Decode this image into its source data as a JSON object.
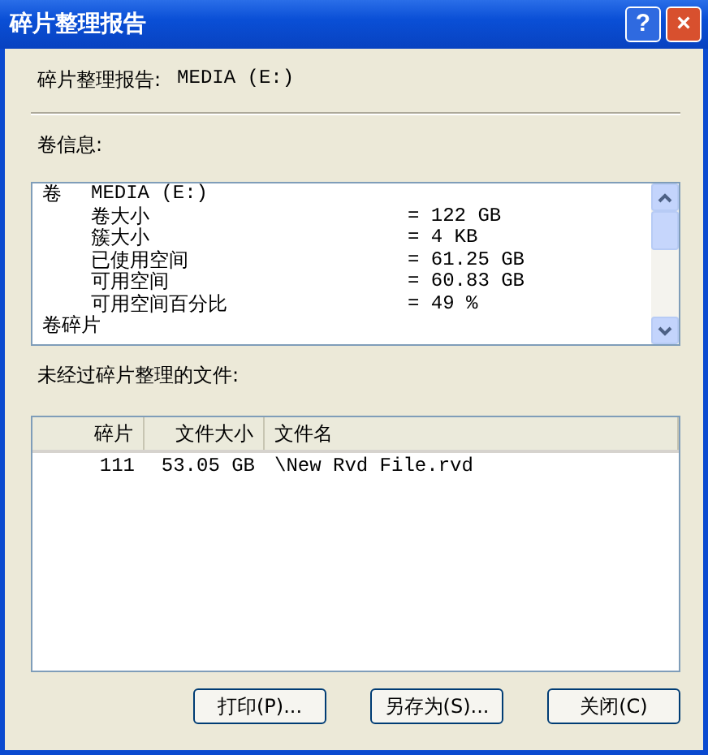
{
  "window": {
    "title": "碎片整理报告",
    "buttons": [
      "?",
      "×"
    ]
  },
  "report_heading": {
    "label": "碎片整理报告:",
    "volume": "MEDIA (E:)"
  },
  "volume_info": {
    "label": "卷信息:",
    "lines": [
      {
        "label": "卷",
        "value": "MEDIA (E:)",
        "children": [
          {
            "label": "卷大小",
            "value": "= 122 GB"
          },
          {
            "label": "簇大小",
            "value": "= 4 KB"
          },
          {
            "label": "已使用空间",
            "value": "= 61.25 GB"
          },
          {
            "label": "可用空间",
            "value": "= 60.83 GB"
          },
          {
            "label": "可用空间百分比",
            "value": "= 49 %"
          }
        ]
      },
      {
        "label": "卷碎片"
      }
    ]
  },
  "files": {
    "label": "未经过碎片整理的文件:",
    "columns": [
      "碎片",
      "文件大小",
      "文件名"
    ],
    "rows": [
      [
        "111",
        "53.05 GB",
        "\\New Rvd File.rvd"
      ]
    ]
  },
  "buttons": [
    "打印(P)...",
    "另存为(S)...",
    "关闭(C)"
  ]
}
